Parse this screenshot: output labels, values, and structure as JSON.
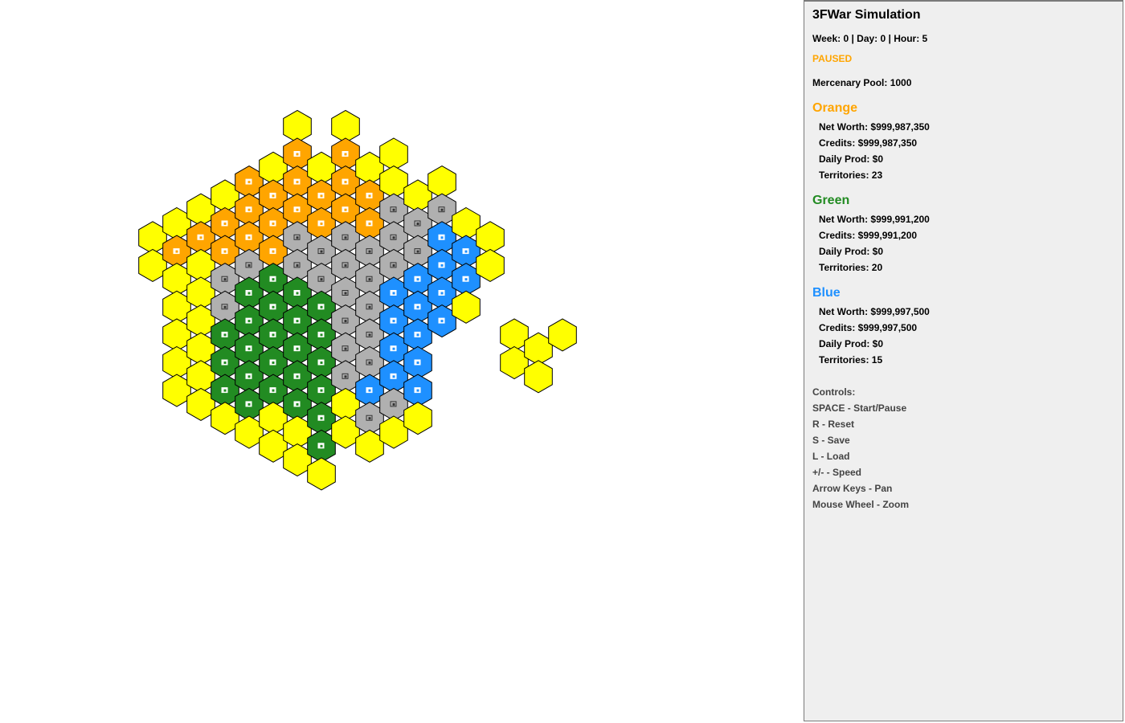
{
  "map": {
    "colors": {
      "yellow": "#ffff00",
      "orange": "#ffa500",
      "green": "#228b22",
      "blue": "#1e90ff",
      "gray": "#b0b0b0"
    },
    "icon": "building-icon"
  },
  "panel": {
    "title": "3FWar Simulation",
    "time": "Week: 0 | Day: 0 | Hour: 5",
    "status": "PAUSED",
    "status_color": "#ffa500",
    "mercenary_pool": "Mercenary Pool: 1000",
    "factions": [
      {
        "name": "Orange",
        "color": "#ffa500",
        "net_worth": "Net Worth: $999,987,350",
        "credits": "Credits: $999,987,350",
        "daily_prod": "Daily Prod: $0",
        "territories": "Territories: 23"
      },
      {
        "name": "Green",
        "color": "#228b22",
        "net_worth": "Net Worth: $999,991,200",
        "credits": "Credits: $999,991,200",
        "daily_prod": "Daily Prod: $0",
        "territories": "Territories: 20"
      },
      {
        "name": "Blue",
        "color": "#1e90ff",
        "net_worth": "Net Worth: $999,997,500",
        "credits": "Credits: $999,997,500",
        "daily_prod": "Daily Prod: $0",
        "territories": "Territories: 15"
      }
    ],
    "controls_title": "Controls:",
    "controls": [
      "SPACE - Start/Pause",
      "R - Reset",
      "S - Save",
      "L - Load",
      "+/- - Speed",
      "Arrow Keys - Pan",
      "Mouse Wheel - Zoom"
    ]
  }
}
